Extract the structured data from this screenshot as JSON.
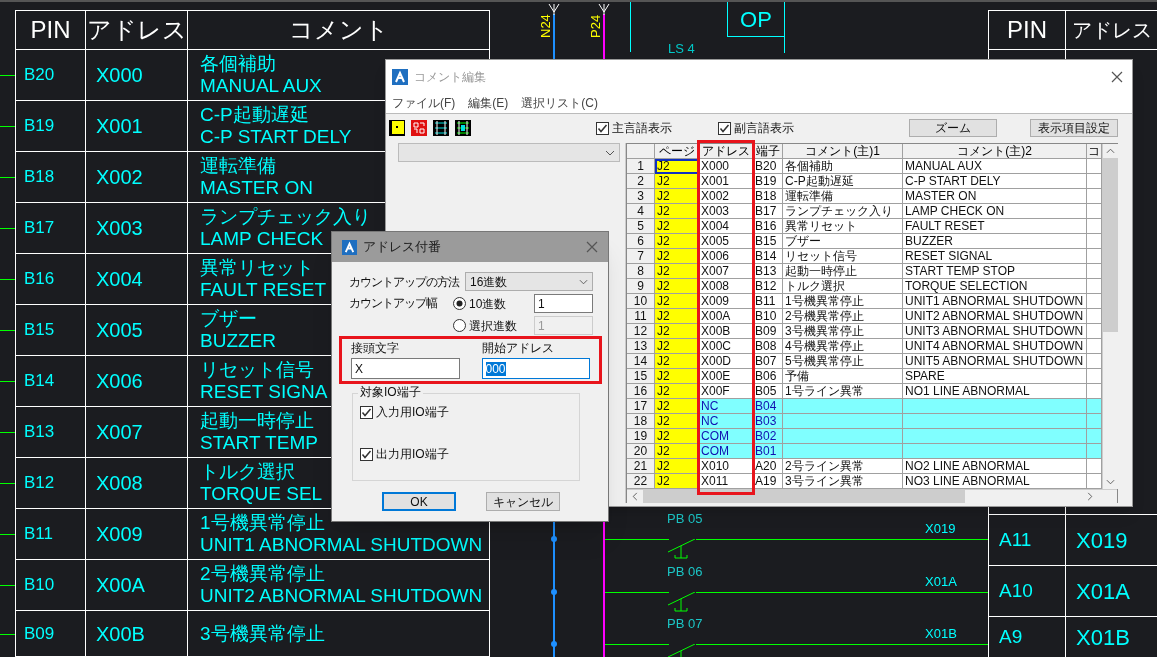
{
  "cad_drawing": {
    "left_table": {
      "columns": [
        "PIN",
        "アドレス",
        "コメント"
      ],
      "rows": [
        {
          "pin": "B20",
          "address": "X000",
          "comment": [
            "各個補助",
            "MANUAL AUX"
          ]
        },
        {
          "pin": "B19",
          "address": "X001",
          "comment": [
            "C-P起動遅延",
            "C-P START DELY"
          ]
        },
        {
          "pin": "B18",
          "address": "X002",
          "comment": [
            "運転準備",
            "MASTER ON"
          ]
        },
        {
          "pin": "B17",
          "address": "X003",
          "comment": [
            "ランプチェック入り",
            "LAMP CHECK"
          ]
        },
        {
          "pin": "B16",
          "address": "X004",
          "comment": [
            "異常リセット",
            "FAULT RESET"
          ]
        },
        {
          "pin": "B15",
          "address": "X005",
          "comment": [
            "ブザー",
            "BUZZER"
          ]
        },
        {
          "pin": "B14",
          "address": "X006",
          "comment": [
            "リセット信号",
            "RESET SIGNA"
          ]
        },
        {
          "pin": "B13",
          "address": "X007",
          "comment": [
            "起動一時停止",
            "START TEMP"
          ]
        },
        {
          "pin": "B12",
          "address": "X008",
          "comment": [
            "トルク選択",
            "TORQUE SEL"
          ]
        },
        {
          "pin": "B11",
          "address": "X009",
          "comment": [
            "1号機異常停止",
            "UNIT1 ABNORMAL SHUTDOWN"
          ]
        },
        {
          "pin": "B10",
          "address": "X00A",
          "comment": [
            "2号機異常停止",
            "UNIT2 ABNORMAL SHUTDOWN"
          ]
        },
        {
          "pin": "B09",
          "address": "X00B",
          "comment": [
            "3号機異常停止"
          ]
        }
      ]
    },
    "right_table": {
      "columns": [
        "PIN",
        "アドレス"
      ],
      "rows": [
        {
          "pin": "A11",
          "address": "X019"
        },
        {
          "pin": "A10",
          "address": "X01A"
        },
        {
          "pin": "A9",
          "address": "X01B"
        }
      ]
    },
    "bus_labels": [
      "N24",
      "P24"
    ],
    "op_label": "OP",
    "ls_label": "LS 4",
    "circuits": [
      {
        "switch": "PB 05",
        "signal": "X019"
      },
      {
        "switch": "PB 06",
        "signal": "X01A"
      },
      {
        "switch": "PB 07",
        "signal": "X01B"
      }
    ]
  },
  "comment_editor": {
    "title": "コメント編集",
    "menu": [
      "ファイル(F)",
      "編集(E)",
      "選択リスト(C)"
    ],
    "options": [
      {
        "label": "主言語表示",
        "checked": true
      },
      {
        "label": "副言語表示",
        "checked": true
      }
    ],
    "buttons": [
      "ズーム",
      "表示項目設定"
    ],
    "grid": {
      "columns": [
        {
          "label": "ページ",
          "highlighted": false
        },
        {
          "label": "アドレス",
          "highlighted": true
        },
        {
          "label": "端子",
          "highlighted": false
        },
        {
          "label": "コメント(主)1",
          "highlighted": false
        },
        {
          "label": "コメント(主)2",
          "highlighted": false
        },
        {
          "label": "コ",
          "highlighted": false
        }
      ],
      "rows": [
        {
          "number": "1",
          "page": "J2",
          "address": "X000",
          "terminal": "B20",
          "comment_1": "各個補助",
          "comment_2": "MANUAL AUX",
          "selected": true,
          "highlighted": false
        },
        {
          "number": "2",
          "page": "J2",
          "address": "X001",
          "terminal": "B19",
          "comment_1": "C-P起動遅延",
          "comment_2": "C-P START DELY",
          "selected": false,
          "highlighted": false
        },
        {
          "number": "3",
          "page": "J2",
          "address": "X002",
          "terminal": "B18",
          "comment_1": "運転準備",
          "comment_2": "MASTER ON",
          "selected": false,
          "highlighted": false
        },
        {
          "number": "4",
          "page": "J2",
          "address": "X003",
          "terminal": "B17",
          "comment_1": "ランプチェック入り",
          "comment_2": "LAMP CHECK ON",
          "selected": false,
          "highlighted": false
        },
        {
          "number": "5",
          "page": "J2",
          "address": "X004",
          "terminal": "B16",
          "comment_1": "異常リセット",
          "comment_2": "FAULT RESET",
          "selected": false,
          "highlighted": false
        },
        {
          "number": "6",
          "page": "J2",
          "address": "X005",
          "terminal": "B15",
          "comment_1": "ブザー",
          "comment_2": "BUZZER",
          "selected": false,
          "highlighted": false
        },
        {
          "number": "7",
          "page": "J2",
          "address": "X006",
          "terminal": "B14",
          "comment_1": "リセット信号",
          "comment_2": "RESET SIGNAL",
          "selected": false,
          "highlighted": false
        },
        {
          "number": "8",
          "page": "J2",
          "address": "X007",
          "terminal": "B13",
          "comment_1": "起動一時停止",
          "comment_2": "START TEMP STOP",
          "selected": false,
          "highlighted": false
        },
        {
          "number": "9",
          "page": "J2",
          "address": "X008",
          "terminal": "B12",
          "comment_1": "トルク選択",
          "comment_2": "TORQUE SELECTION",
          "selected": false,
          "highlighted": false
        },
        {
          "number": "10",
          "page": "J2",
          "address": "X009",
          "terminal": "B11",
          "comment_1": "1号機異常停止",
          "comment_2": "UNIT1 ABNORMAL SHUTDOWN",
          "selected": false,
          "highlighted": false
        },
        {
          "number": "11",
          "page": "J2",
          "address": "X00A",
          "terminal": "B10",
          "comment_1": "2号機異常停止",
          "comment_2": "UNIT2 ABNORMAL SHUTDOWN",
          "selected": false,
          "highlighted": false
        },
        {
          "number": "12",
          "page": "J2",
          "address": "X00B",
          "terminal": "B09",
          "comment_1": "3号機異常停止",
          "comment_2": "UNIT3 ABNORMAL SHUTDOWN",
          "selected": false,
          "highlighted": false
        },
        {
          "number": "13",
          "page": "J2",
          "address": "X00C",
          "terminal": "B08",
          "comment_1": "4号機異常停止",
          "comment_2": "UNIT4 ABNORMAL SHUTDOWN",
          "selected": false,
          "highlighted": false
        },
        {
          "number": "14",
          "page": "J2",
          "address": "X00D",
          "terminal": "B07",
          "comment_1": "5号機異常停止",
          "comment_2": "UNIT5 ABNORMAL SHUTDOWN",
          "selected": false,
          "highlighted": false
        },
        {
          "number": "15",
          "page": "J2",
          "address": "X00E",
          "terminal": "B06",
          "comment_1": "予備",
          "comment_2": "SPARE",
          "selected": false,
          "highlighted": false
        },
        {
          "number": "16",
          "page": "J2",
          "address": "X00F",
          "terminal": "B05",
          "comment_1": "1号ライン異常",
          "comment_2": "NO1 LINE ABNORMAL",
          "selected": false,
          "highlighted": false
        },
        {
          "number": "17",
          "page": "J2",
          "address": "NC",
          "terminal": "B04",
          "selected": false,
          "highlighted": true
        },
        {
          "number": "18",
          "page": "J2",
          "address": "NC",
          "terminal": "B03",
          "selected": false,
          "highlighted": true
        },
        {
          "number": "19",
          "page": "J2",
          "address": "COM",
          "terminal": "B02",
          "selected": false,
          "highlighted": true
        },
        {
          "number": "20",
          "page": "J2",
          "address": "COM",
          "terminal": "B01",
          "selected": false,
          "highlighted": true
        },
        {
          "number": "21",
          "page": "J2",
          "address": "X010",
          "terminal": "A20",
          "comment_1": "2号ライン異常",
          "comment_2": "NO2 LINE ABNORMAL",
          "selected": false,
          "highlighted": false
        },
        {
          "number": "22",
          "page": "J2",
          "address": "X011",
          "terminal": "A19",
          "comment_1": "3号ライン異常",
          "comment_2": "NO3 LINE ABNORMAL",
          "selected": false,
          "highlighted": false
        }
      ]
    }
  },
  "address_dialog": {
    "title": "アドレス付番",
    "count_method_label": "カウントアップの方法",
    "count_method": "16進数",
    "step_label": "カウントアップ幅",
    "step_options": [
      {
        "label": "10進数",
        "selected": true,
        "value": "1",
        "disabled": false
      },
      {
        "label": "選択進数",
        "selected": false,
        "value": "1",
        "disabled": true
      }
    ],
    "fields_highlighted": true,
    "prefix": {
      "label": "接頭文字",
      "value": "X"
    },
    "start_address": {
      "label": "開始アドレス",
      "value": "000",
      "text_selected": true
    },
    "target_group": {
      "label": "対象IO端子",
      "options": [
        {
          "label": "入力用IO端子",
          "checked": true
        },
        {
          "label": "出力用IO端子",
          "checked": true
        }
      ]
    },
    "buttons": [
      {
        "label": "OK",
        "default": true
      },
      {
        "label": "キャンセル",
        "default": false
      }
    ]
  }
}
